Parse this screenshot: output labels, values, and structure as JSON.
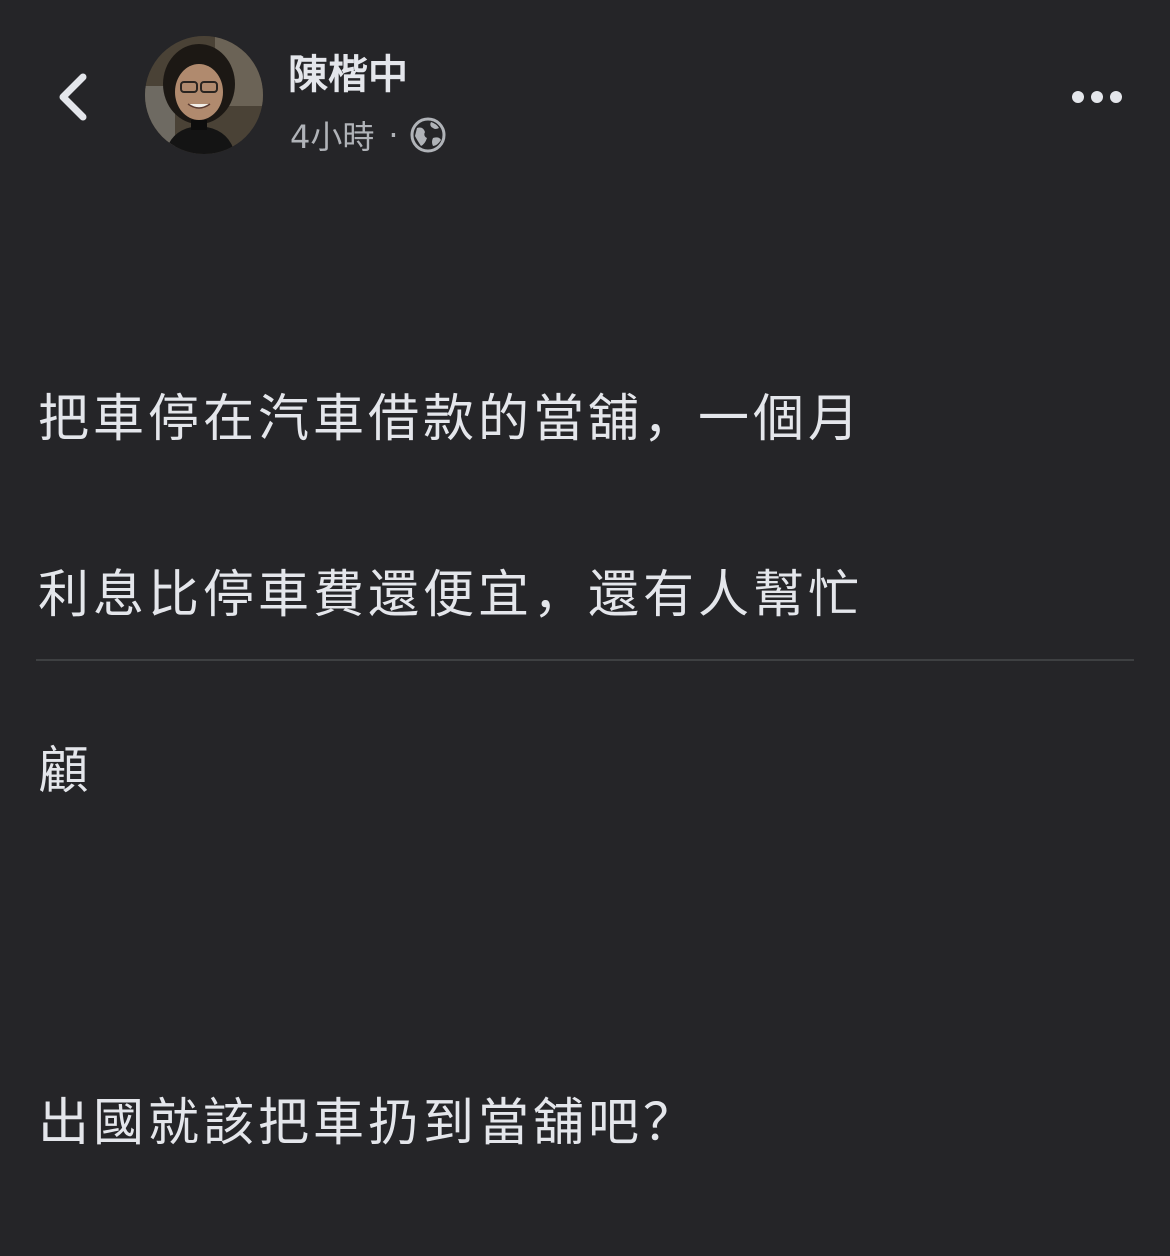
{
  "post": {
    "author_name": "陳楷中",
    "timestamp": "4小時",
    "separator": "·",
    "audience_icon": "globe-icon",
    "back_icon": "chevron-left-icon",
    "more_icon": "more-horizontal-icon",
    "body_line_1": "把車停在汽車借款的當舖，一個月",
    "body_line_2": "利息比停車費還便宜，還有人幫忙",
    "body_line_3": "顧",
    "body_paragraph_2": "出國就該把車扔到當舖吧？"
  },
  "colors": {
    "background": "#252528",
    "primary_text": "#e4e6eb",
    "secondary_text": "#b0b3b8",
    "divider": "#3e4042"
  }
}
